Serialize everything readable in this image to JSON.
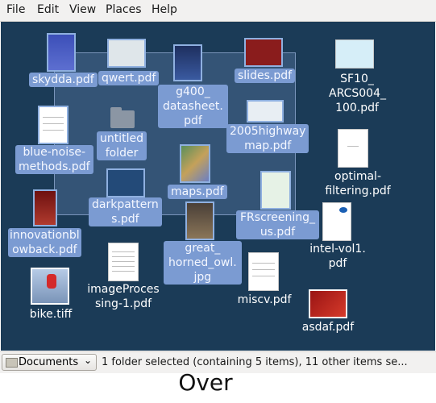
{
  "menu": [
    "File",
    "Edit",
    "View",
    "Places",
    "Help"
  ],
  "selection_box": "visible",
  "files": [
    {
      "name": "skydda.pdf",
      "label_lines": "skydda.pdf",
      "selected": true,
      "thumb": "blue-doc"
    },
    {
      "name": "qwert.pdf",
      "label_lines": "qwert.pdf",
      "selected": true,
      "thumb": "slide"
    },
    {
      "name": "g400_datasheet.pdf",
      "label_lines": "g400_\ndatasheet.\npdf",
      "selected": true,
      "thumb": "dark-doc"
    },
    {
      "name": "slides.pdf",
      "label_lines": "slides.pdf",
      "selected": true,
      "thumb": "red-slide"
    },
    {
      "name": "SF10_ARCS004_100.pdf",
      "label_lines": "SF10_\nARCS004_\n100.pdf",
      "selected": false,
      "thumb": "web"
    },
    {
      "name": "blue-noise-methods.pdf",
      "label_lines": "blue-noise-\nmethods.pdf",
      "selected": true,
      "thumb": "paper"
    },
    {
      "name": "untitled folder",
      "label_lines": "untitled\nfolder",
      "selected": true,
      "thumb": "folder"
    },
    {
      "name": "2005highwaymap.pdf",
      "label_lines": "2005highway\nmap.pdf",
      "selected": true,
      "thumb": "map-doc"
    },
    {
      "name": "optimal-filtering.pdf",
      "label_lines": "optimal-\nfiltering.pdf",
      "selected": false,
      "thumb": "white-doc"
    },
    {
      "name": "darkpatterns.pdf",
      "label_lines": "darkpattern\ns.pdf",
      "selected": true,
      "thumb": "slide"
    },
    {
      "name": "maps.pdf",
      "label_lines": "maps.pdf",
      "selected": true,
      "thumb": "color-map"
    },
    {
      "name": "FRscreening_us.pdf",
      "label_lines": "FRscreening_\nus.pdf",
      "selected": true,
      "thumb": "green-doc"
    },
    {
      "name": "intel-vol1.pdf",
      "label_lines": "intel-vol1.\npdf",
      "selected": false,
      "thumb": "intel"
    },
    {
      "name": "innovationblowback.pdf",
      "label_lines": "innovationbl\nowback.pdf",
      "selected": true,
      "thumb": "red-doc"
    },
    {
      "name": "great_horned_owl.jpg",
      "label_lines": "great_\nhorned_owl.\njpg",
      "selected": true,
      "thumb": "photo"
    },
    {
      "name": "imageProcessing-1.pdf",
      "label_lines": "imageProces\nsing-1.pdf",
      "selected": false,
      "thumb": "paper"
    },
    {
      "name": "miscv.pdf",
      "label_lines": "miscv.pdf",
      "selected": false,
      "thumb": "paper"
    },
    {
      "name": "bike.tiff",
      "label_lines": "bike.tiff",
      "selected": false,
      "thumb": "bike"
    },
    {
      "name": "asdaf.pdf",
      "label_lines": "asdaf.pdf",
      "selected": false,
      "thumb": "red-slide"
    }
  ],
  "statusbar": {
    "places_selected": "Documents",
    "status": "1 folder selected (containing 5 items), 11 other items se..."
  },
  "caption": "Over",
  "colors": {
    "desktop": "#1b3b57",
    "selection": "#7b9bd2"
  }
}
